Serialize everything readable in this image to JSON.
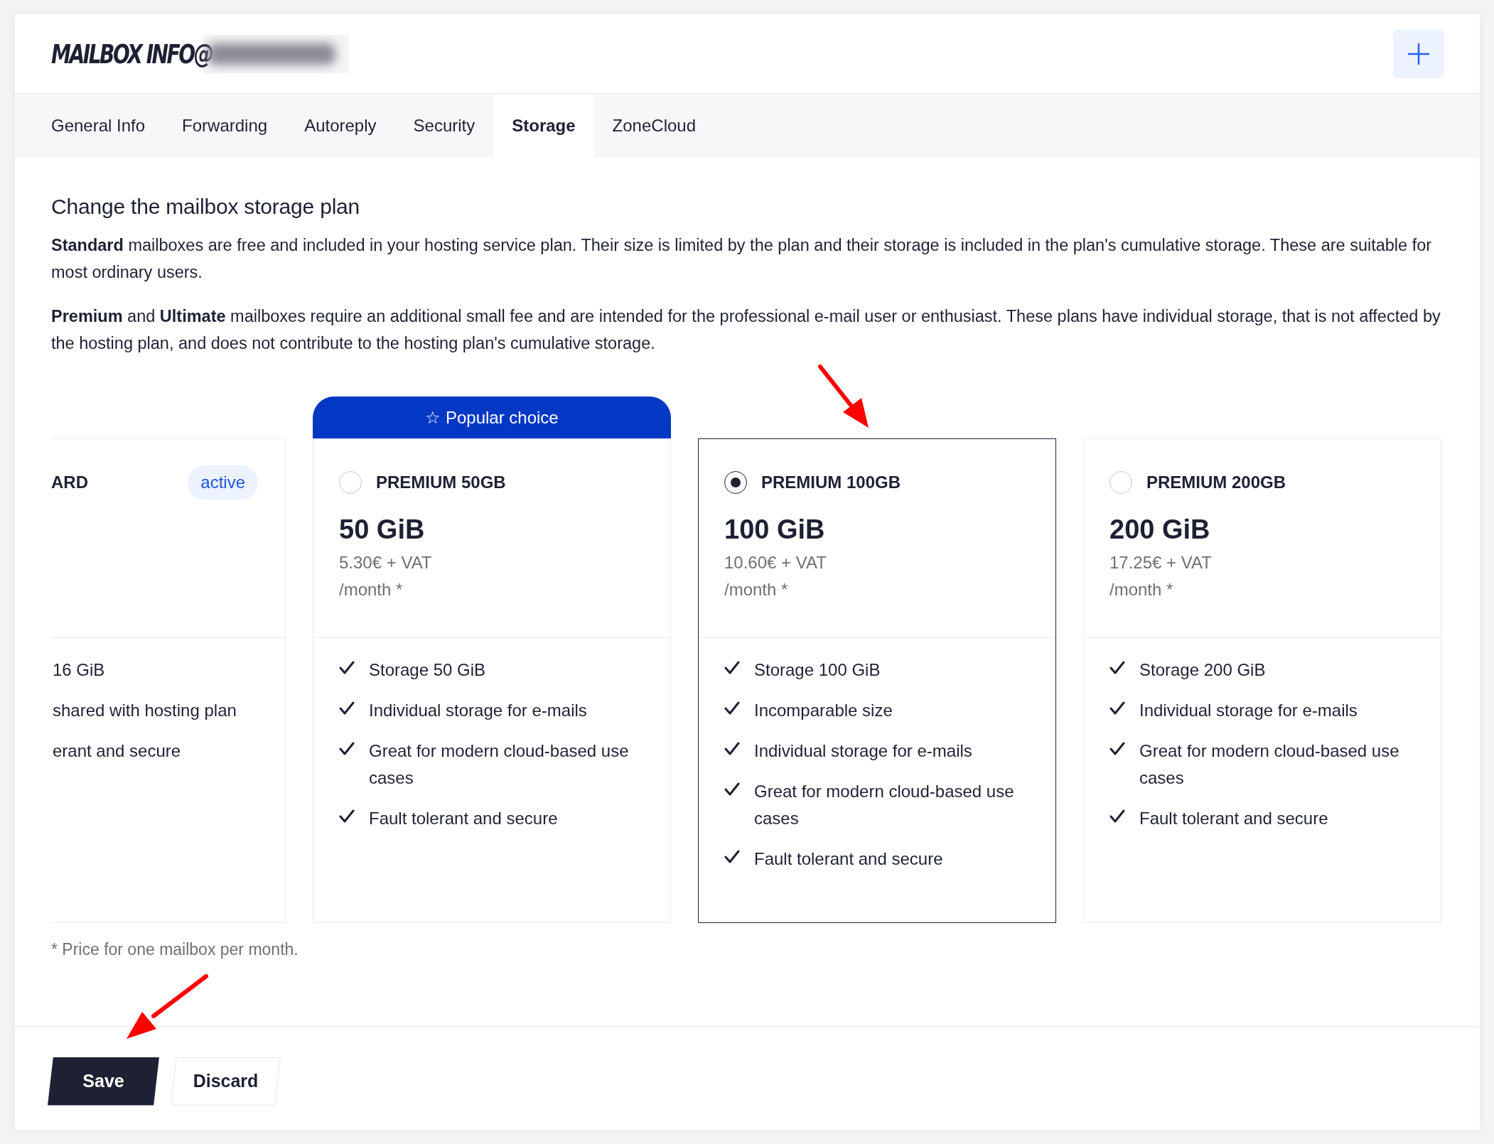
{
  "header": {
    "title": "MAILBOX INFO@"
  },
  "tabs": [
    {
      "label": "General Info",
      "selected": false
    },
    {
      "label": "Forwarding",
      "selected": false
    },
    {
      "label": "Autoreply",
      "selected": false
    },
    {
      "label": "Security",
      "selected": false
    },
    {
      "label": "Storage",
      "selected": true
    },
    {
      "label": "ZoneCloud",
      "selected": false
    }
  ],
  "section": {
    "heading": "Change the mailbox storage plan",
    "paragraphs": [
      "**Standard** mailboxes are free and included in your hosting service plan. Their size is limited by the plan and their storage is included in the plan's cumulative storage. These are suitable for most ordinary users.",
      "**Premium** and **Ultimate** mailboxes require an additional small fee and are intended for the professional e-mail user or enthusiast. These plans have individual storage, that is not affected by the hosting plan, and does not contribute to the hosting plan's cumulative storage."
    ]
  },
  "plans": [
    {
      "kind": "current",
      "name": "ARD",
      "badge": "active",
      "features": [
        "16 GiB",
        "shared with hosting plan",
        "erant and secure"
      ]
    },
    {
      "kind": "option",
      "ribbon": "☆ Popular choice",
      "name": "PREMIUM 50GB",
      "selected": false,
      "size": "50 GiB",
      "price": "5.30€ + VAT",
      "period": "/month *",
      "features": [
        "Storage 50 GiB",
        "Individual storage for e-mails",
        "Great for modern cloud-based use cases",
        "Fault tolerant and secure"
      ]
    },
    {
      "kind": "option",
      "name": "PREMIUM 100GB",
      "selected": true,
      "size": "100 GiB",
      "price": "10.60€ + VAT",
      "period": "/month *",
      "features": [
        "Storage 100 GiB",
        "Incomparable size",
        "Individual storage for e-mails",
        "Great for modern cloud-based use cases",
        "Fault tolerant and secure"
      ]
    },
    {
      "kind": "option",
      "name": "PREMIUM 200GB",
      "selected": false,
      "size": "200 GiB",
      "price": "17.25€ + VAT",
      "period": "/month *",
      "features": [
        "Storage 200 GiB",
        "Individual storage for e-mails",
        "Great for modern cloud-based use cases",
        "Fault tolerant and secure"
      ]
    }
  ],
  "footnote": "* Price for one mailbox per month.",
  "buttons": [
    {
      "label": "Save",
      "kind": "primary"
    },
    {
      "label": "Discard",
      "kind": "secondary"
    }
  ]
}
